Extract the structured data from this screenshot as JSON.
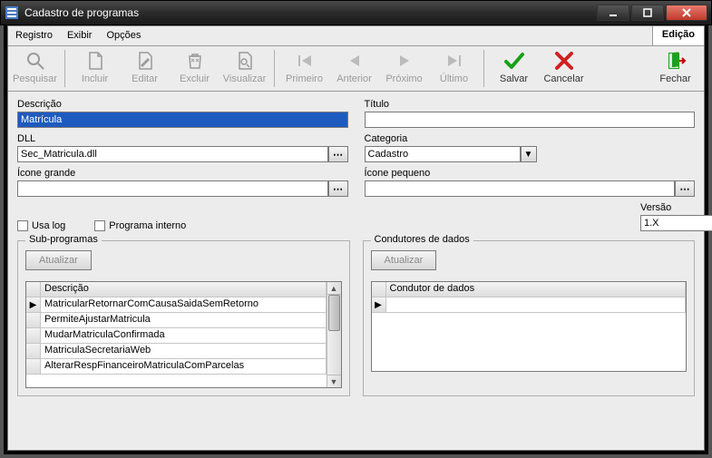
{
  "window": {
    "title": "Cadastro de programas"
  },
  "menubar": {
    "items": [
      "Registro",
      "Exibir",
      "Opções"
    ]
  },
  "mode_badge": "Edição",
  "toolbar": {
    "pesquisar": "Pesquisar",
    "incluir": "Incluir",
    "editar": "Editar",
    "excluir": "Excluir",
    "visualizar": "Visualizar",
    "primeiro": "Primeiro",
    "anterior": "Anterior",
    "proximo": "Próximo",
    "ultimo": "Último",
    "salvar": "Salvar",
    "cancelar": "Cancelar",
    "fechar": "Fechar"
  },
  "form": {
    "descricao_label": "Descrição",
    "descricao_value": "Matrícula",
    "titulo_label": "Título",
    "titulo_value": "",
    "dll_label": "DLL",
    "dll_value": "Sec_Matricula.dll",
    "categoria_label": "Categoria",
    "categoria_value": "Cadastro",
    "icone_grande_label": "Ícone grande",
    "icone_grande_value": "",
    "icone_pequeno_label": "Ícone pequeno",
    "icone_pequeno_value": "",
    "usa_log_label": "Usa log",
    "programa_interno_label": "Programa interno",
    "versao_label": "Versão",
    "versao_value": "1.X"
  },
  "subprogramas": {
    "legend": "Sub-programas",
    "atualizar": "Atualizar",
    "header": "Descrição",
    "rows": [
      "MatricularRetornarComCausaSaidaSemRetorno",
      "PermiteAjustarMatricula",
      "MudarMatriculaConfirmada",
      "MatriculaSecretariaWeb",
      "AlterarRespFinanceiroMatriculaComParcelas"
    ]
  },
  "condutores": {
    "legend": "Condutores de dados",
    "atualizar": "Atualizar",
    "header": "Condutor de dados"
  }
}
